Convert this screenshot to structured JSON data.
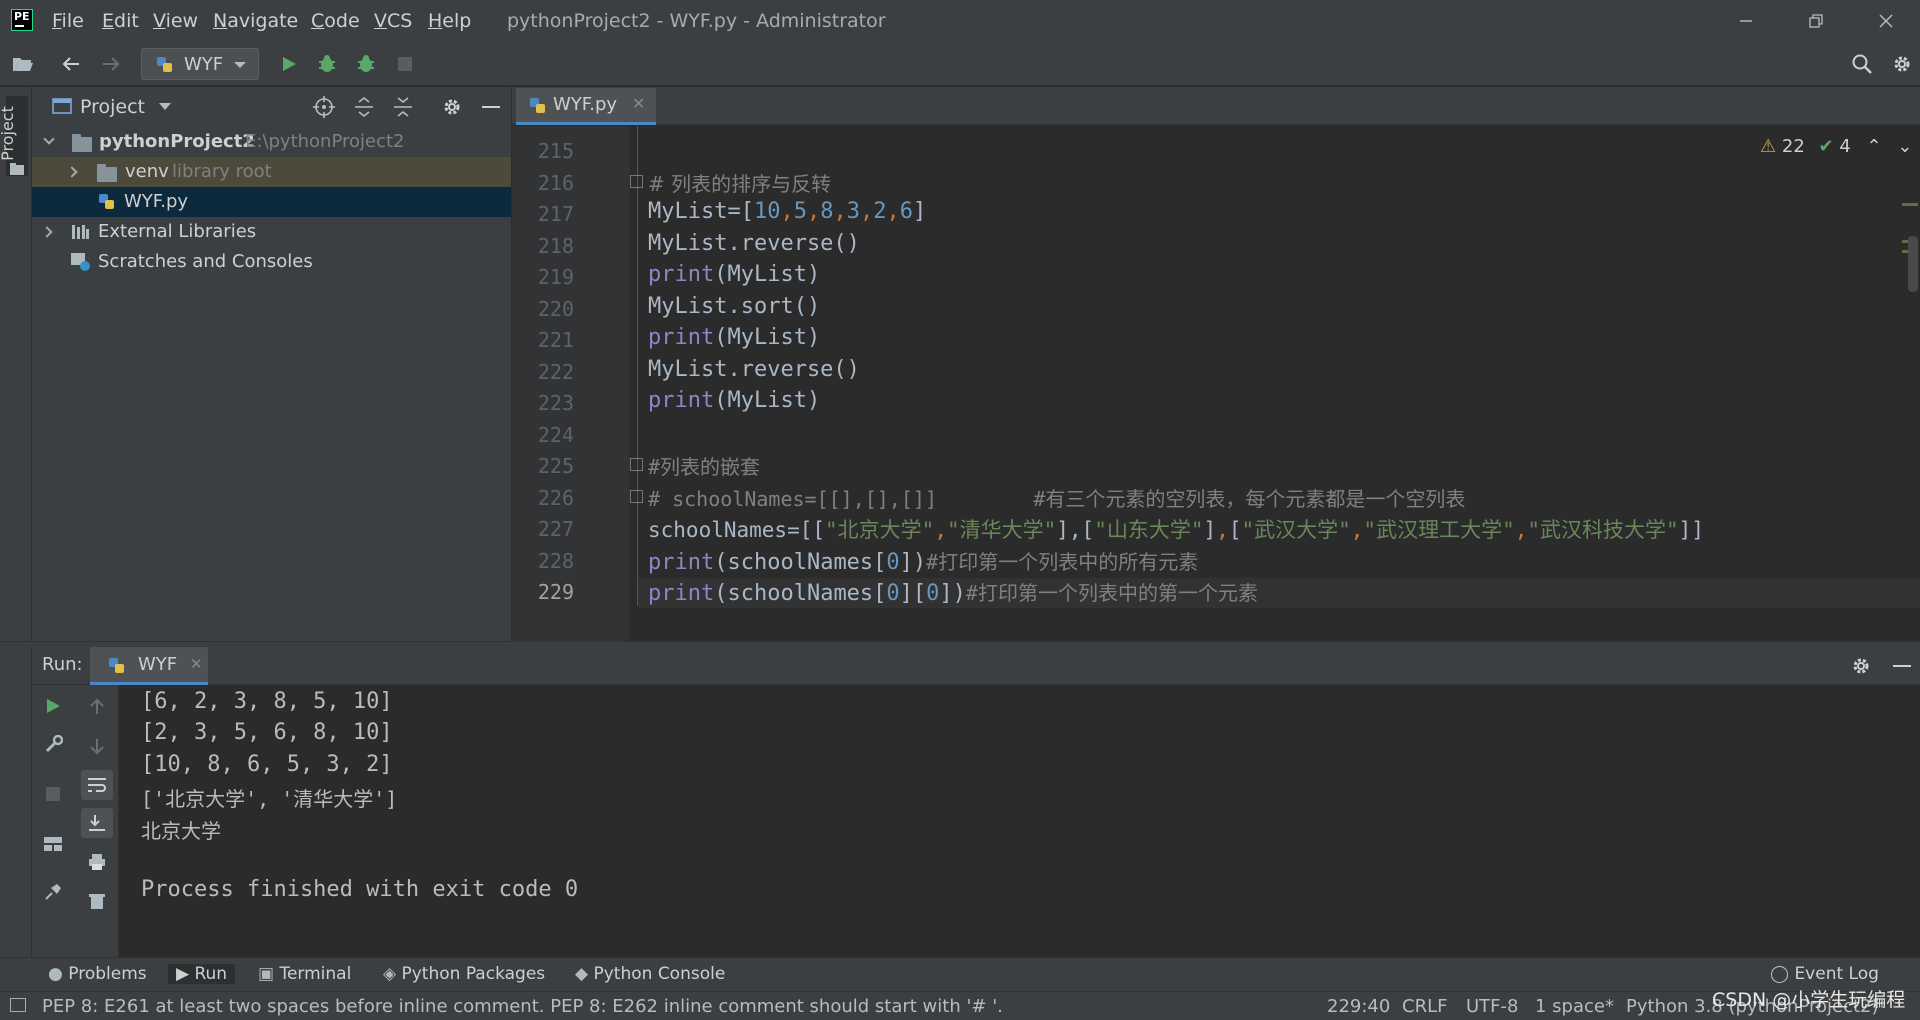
{
  "window": {
    "title": "pythonProject2 - WYF.py - Administrator"
  },
  "menu": [
    "File",
    "Edit",
    "View",
    "Navigate",
    "Code",
    "VCS",
    "Help"
  ],
  "menu_mnemonics": [
    "F",
    "E",
    "V",
    "N",
    "C",
    "V",
    "H"
  ],
  "toolbar": {
    "run_config": "WYF"
  },
  "left_stripe": {
    "project_label": "Project"
  },
  "project_panel": {
    "title": "Project",
    "tree": [
      {
        "name": "pythonProject2",
        "extra": "E:\\pythonProject2"
      },
      {
        "name": "venv",
        "extra": "library root"
      },
      {
        "name": "WYF.py",
        "extra": ""
      },
      {
        "name": "External Libraries",
        "extra": ""
      },
      {
        "name": "Scratches and Consoles",
        "extra": ""
      }
    ]
  },
  "editor": {
    "tab": "WYF.py",
    "inspections": {
      "warnings": "22",
      "ok": "4"
    },
    "line_numbers": [
      "215",
      "216",
      "217",
      "218",
      "219",
      "220",
      "221",
      "222",
      "223",
      "224",
      "225",
      "226",
      "227",
      "228",
      "229"
    ],
    "lines": {
      "l216": "# 列表的排序与反转",
      "l217_a": "MyList=[",
      "l217_n1": "10",
      "l217_n2": "5",
      "l217_n3": "8",
      "l217_n4": "3",
      "l217_n5": "2",
      "l217_n6": "6",
      "l217_b": "]",
      "l218": "MyList.reverse()",
      "l219_kw": "print",
      "l219_rest": "(MyList)",
      "l220": "MyList.sort()",
      "l221_kw": "print",
      "l221_rest": "(MyList)",
      "l222": "MyList.reverse()",
      "l223_kw": "print",
      "l223_rest": "(MyList)",
      "l225": "#列表的嵌套",
      "l226": "# schoolNames=[[],[],[]]        #有三个元素的空列表，每个元素都是一个空列表",
      "l227_a": "schoolNames=[[",
      "l227_s1": "\"北京大学\"",
      "l227_s2": "\"清华大学\"",
      "l227_s3": "\"山东大学\"",
      "l227_s4": "\"武汉大学\"",
      "l227_s5": "\"武汉理工大学\"",
      "l227_s6": "\"武汉科技大学\"",
      "l228_kw": "print",
      "l228_a": "(schoolNames[",
      "l228_n": "0",
      "l228_b": "])",
      "l228_c": "#打印第一个列表中的所有元素",
      "l229_kw": "print",
      "l229_a": "(schoolNames[",
      "l229_n1": "0",
      "l229_m": "][",
      "l229_n2": "0",
      "l229_b": "])",
      "l229_c": "#打印第一个列表中的第一个元素"
    }
  },
  "run_panel": {
    "label": "Run:",
    "tab": "WYF",
    "output": [
      "[6, 2, 3, 8, 5, 10]",
      "[2, 3, 5, 6, 8, 10]",
      "[10, 8, 6, 5, 3, 2]",
      "['北京大学', '清华大学']",
      "北京大学",
      "",
      "Process finished with exit code 0"
    ]
  },
  "bottom_tabs": [
    "Problems",
    "Run",
    "Terminal",
    "Python Packages",
    "Python Console",
    "Event Log"
  ],
  "status_bar": {
    "message": "PEP 8: E261 at least two spaces before inline comment. PEP 8: E262 inline comment should start with '# '.",
    "position": "229:40",
    "line_sep": "CRLF",
    "encoding": "UTF-8",
    "indent": "1 space*",
    "interpreter": "Python 3.8 (pythonProject2)"
  },
  "watermark": "CSDN @小学生玩编程",
  "colors": {
    "background": "#2b2b2b",
    "panel": "#3c3f41",
    "accent": "#4a88c7",
    "keyword": "#8888c6",
    "number": "#6897bb",
    "string": "#6a8759",
    "comment": "#808080",
    "run_green": "#59a869"
  }
}
